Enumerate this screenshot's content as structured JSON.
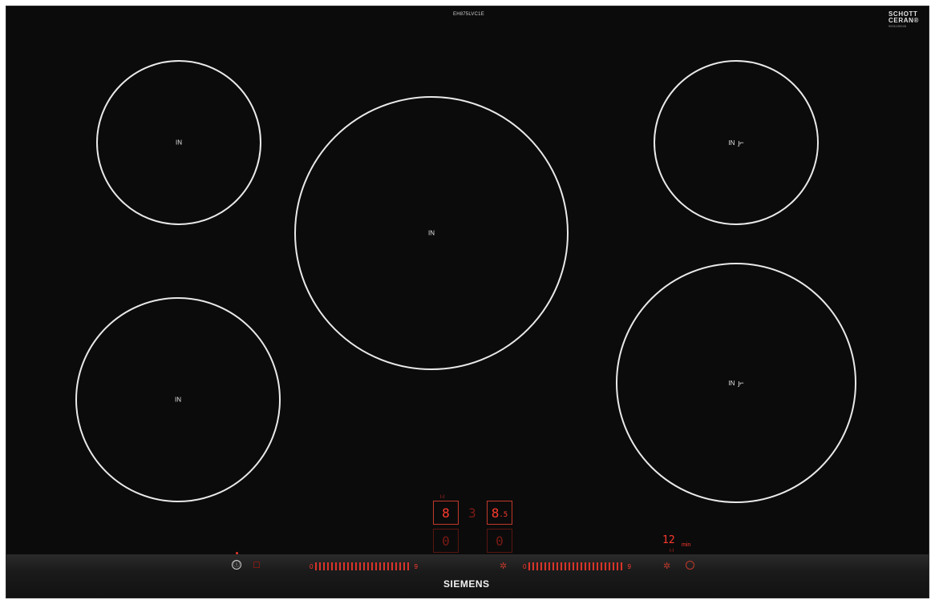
{
  "header": {
    "model": "EH875LVC1E"
  },
  "brand": {
    "line1": "SCHOTT",
    "line2": "CERAN®",
    "small": "9001109245"
  },
  "zones": [
    {
      "label": "IN",
      "pan_icon": ""
    },
    {
      "label": "IN",
      "pan_icon": ""
    },
    {
      "label": "IN",
      "pan_icon": ""
    },
    {
      "label": "IN",
      "pan_icon": "ȷ⌐"
    },
    {
      "label": "IN",
      "pan_icon": "ȷ⌐"
    }
  ],
  "displays": {
    "top_left": "8",
    "top_mid": "3",
    "top_right_main": "8",
    "top_right_sub": ".5",
    "bottom_left": "0",
    "bottom_right": "0",
    "top_left_marker": "I-I",
    "timer": "12",
    "timer_unit": "min",
    "timer_marker": "I-I"
  },
  "controls": {
    "slider_left": {
      "start": "0",
      "end": "9"
    },
    "slider_right": {
      "start": "0",
      "end": "9"
    }
  },
  "footer": {
    "logo": "SIEMENS"
  },
  "colors": {
    "glass": "#0b0b0b",
    "zone_outline": "#e9e9e9",
    "display_red": "#ff3a2d"
  }
}
